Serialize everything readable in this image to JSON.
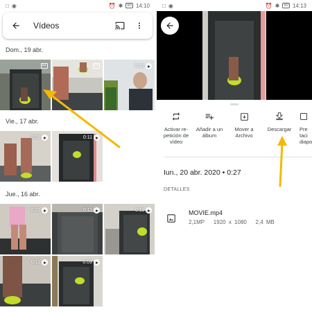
{
  "left": {
    "status": {
      "carrier": "□",
      "wifi": "◉",
      "battery_pct": "90",
      "time": "14:10"
    },
    "appbar": {
      "title": "Vídeos",
      "back_icon": "arrow-back-icon",
      "cast_icon": "cast-icon",
      "menu_icon": "more-vert-icon"
    },
    "sections": [
      {
        "date": "Dom., 19 abr.",
        "items": [
          {
            "duration": "",
            "type": "motion"
          },
          {
            "duration": "",
            "type": "motion"
          },
          {
            "duration": "0:10",
            "type": "video"
          }
        ]
      },
      {
        "date": "Vie., 17 abr.",
        "items": [
          {
            "duration": "0:09",
            "type": "video"
          },
          {
            "duration": "0:11",
            "type": "video"
          }
        ]
      },
      {
        "date": "Jue., 16 abr.",
        "items": [
          {
            "duration": "0:21",
            "type": "video"
          },
          {
            "duration": "0:11",
            "type": "video"
          },
          {
            "duration": "0:11",
            "type": "video"
          },
          {
            "duration": "0:11",
            "type": "video"
          },
          {
            "duration": "0:09",
            "type": "video"
          }
        ]
      }
    ]
  },
  "right": {
    "status": {
      "battery_pct": "90",
      "time": "14:13"
    },
    "back_icon": "arrow-back-icon",
    "actions": [
      {
        "label": "Activar re-\npetición de\nvídeo",
        "icon": "repeat-icon"
      },
      {
        "label": "Añadir a un\nálbum",
        "icon": "playlist-add-icon"
      },
      {
        "label": "Mover a\nArchivo",
        "icon": "archive-icon"
      },
      {
        "label": "Descargar",
        "icon": "download-icon"
      },
      {
        "label": "Pre\ntaci\ndiapo",
        "icon": "slideshow-icon"
      }
    ],
    "date": "Iun., 20 abr. 2020  •  0:27",
    "details_label": "DETALLES",
    "file": {
      "name": "MOVIE.mp4",
      "megapixels": "2,1MP",
      "resolution": "1920 x 1080",
      "size": "2,4 MB",
      "icon": "image-icon"
    }
  },
  "colors": {
    "arrow": "#f5b800",
    "accent": "#1a73e8"
  }
}
